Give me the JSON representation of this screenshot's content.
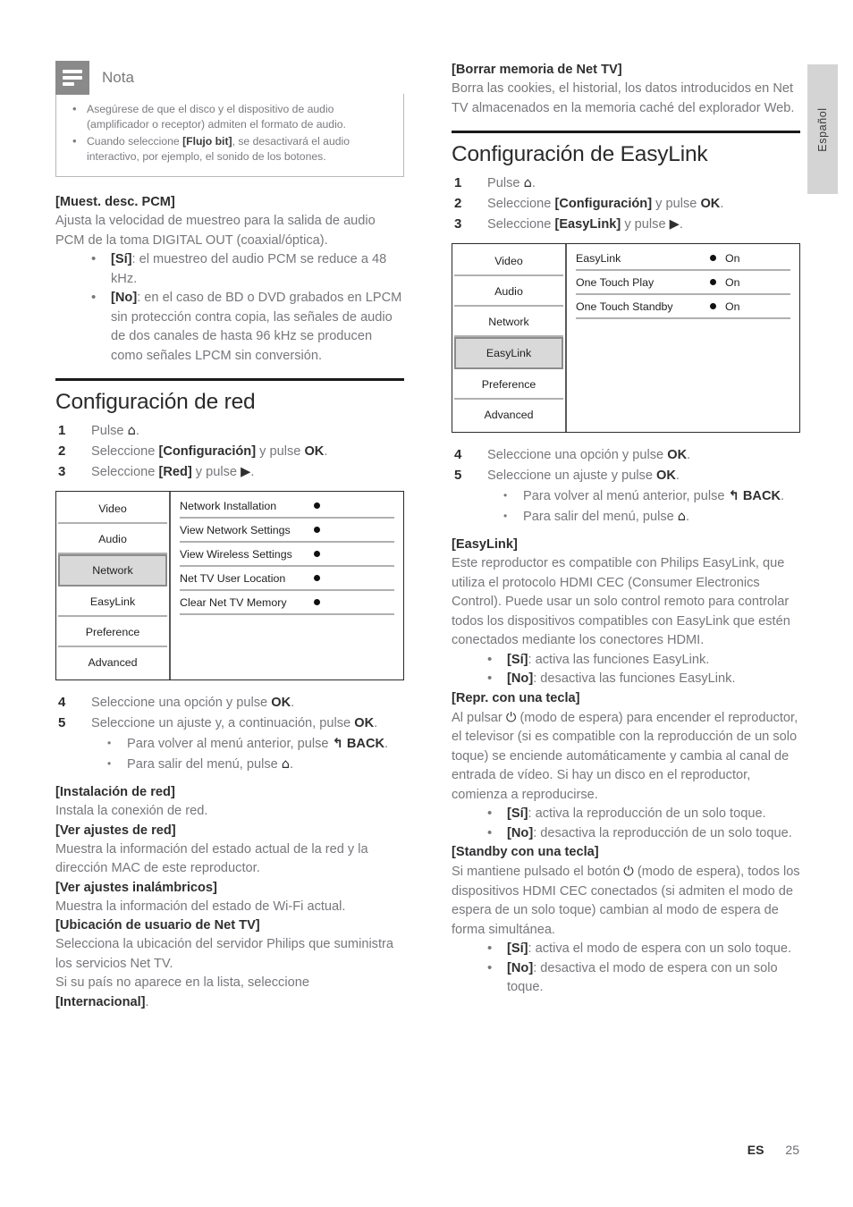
{
  "page": {
    "language_tab": "Español",
    "footer_locale": "ES",
    "footer_page": "25"
  },
  "note": {
    "title": "Nota",
    "items": [
      "Asegúrese de que el disco y el dispositivo de audio (amplificador o receptor) admiten el formato de audio.",
      "Cuando seleccione [Flujo bit], se desactivará el audio interactivo, por ejemplo, el sonido de los botones."
    ],
    "item2_pre": "Cuando seleccione ",
    "item2_bold": "[Flujo bit]",
    "item2_post": ", se desactivará el audio interactivo, por ejemplo, el sonido de los botones."
  },
  "pcm": {
    "term": "[Muest. desc. PCM]",
    "desc": "Ajusta la velocidad de muestreo para la salida de audio PCM de la toma DIGITAL OUT (coaxial/óptica).",
    "bullets": [
      {
        "bold": "[Sí]",
        "text": ": el muestreo del audio PCM se reduce a 48 kHz."
      },
      {
        "bold": "[No]",
        "text": ": en el caso de BD o DVD grabados en LPCM sin protección contra copia, las señales de audio de dos canales de hasta 96 kHz se producen como señales LPCM sin conversión."
      }
    ]
  },
  "network_section": {
    "heading": "Configuración de red",
    "steps": [
      {
        "num": "1",
        "pre": "Pulse ",
        "icon": "home-icon",
        "post": "."
      },
      {
        "num": "2",
        "pre": "Seleccione ",
        "bold": "[Configuración]",
        "mid": " y pulse ",
        "bold2": "OK",
        "post": "."
      },
      {
        "num": "3",
        "pre": "Seleccione ",
        "bold": "[Red]",
        "mid": " y pulse ",
        "icon": "play-right-icon",
        "post": "."
      }
    ],
    "menu": {
      "left_items": [
        "Video",
        "Audio",
        "Network",
        "EasyLink",
        "Preference",
        "Advanced"
      ],
      "selected": "Network",
      "rows": [
        {
          "label": "Network Installation",
          "value": ""
        },
        {
          "label": "View Network Settings",
          "value": ""
        },
        {
          "label": "View Wireless Settings",
          "value": ""
        },
        {
          "label": "Net TV User Location",
          "value": ""
        },
        {
          "label": "Clear Net TV Memory",
          "value": ""
        }
      ]
    },
    "steps2": [
      {
        "num": "4",
        "pre": "Seleccione una opción y pulse ",
        "bold": "OK",
        "post": "."
      },
      {
        "num": "5",
        "pre": "Seleccione un ajuste y, a continuación, pulse ",
        "bold": "OK",
        "post": "."
      }
    ],
    "sub_bullets": [
      {
        "text": "Para volver al menú anterior, pulse ",
        "icon": "back-arrow-icon",
        "bold": "BACK",
        "post": "."
      },
      {
        "text": "Para salir del menú, pulse ",
        "icon": "home-icon",
        "post": "."
      }
    ],
    "defs": [
      {
        "term": "[Instalación de red]",
        "desc": "Instala la conexión de red."
      },
      {
        "term": "[Ver ajustes de red]",
        "desc": "Muestra la información del estado actual de la red y la dirección MAC de este reproductor."
      },
      {
        "term": "[Ver ajustes inalámbricos]",
        "desc": "Muestra la información del estado de Wi-Fi actual."
      },
      {
        "term": "[Ubicación de usuario de Net TV]",
        "desc": "Selecciona la ubicación del servidor Philips que suministra los servicios Net TV."
      }
    ],
    "closing_pre": "Si su país no aparece en la lista, seleccione ",
    "closing_bold": "[Internacional]",
    "closing_post": "."
  },
  "clear_memory": {
    "term": "[Borrar memoria de Net TV]",
    "desc": "Borra las cookies, el historial, los datos introducidos en Net TV almacenados en la memoria caché del explorador Web."
  },
  "easylink_section": {
    "heading": "Configuración de EasyLink",
    "steps": [
      {
        "num": "1",
        "pre": "Pulse ",
        "icon": "home-icon",
        "post": "."
      },
      {
        "num": "2",
        "pre": "Seleccione ",
        "bold": "[Configuración]",
        "mid": " y pulse ",
        "bold2": "OK",
        "post": "."
      },
      {
        "num": "3",
        "pre": "Seleccione ",
        "bold": "[EasyLink]",
        "mid": " y pulse ",
        "icon": "play-right-icon",
        "post": "."
      }
    ],
    "menu": {
      "left_items": [
        "Video",
        "Audio",
        "Network",
        "EasyLink",
        "Preference",
        "Advanced"
      ],
      "selected": "EasyLink",
      "rows": [
        {
          "label": "EasyLink",
          "value": "On"
        },
        {
          "label": "One Touch Play",
          "value": "On"
        },
        {
          "label": "One Touch Standby",
          "value": "On"
        }
      ]
    },
    "steps2": [
      {
        "num": "4",
        "pre": "Seleccione una opción y pulse ",
        "bold": "OK",
        "post": "."
      },
      {
        "num": "5",
        "pre": "Seleccione un ajuste y pulse ",
        "bold": "OK",
        "post": "."
      }
    ],
    "sub_bullets": [
      {
        "text": "Para volver al menú anterior, pulse ",
        "icon": "back-arrow-icon",
        "bold": "BACK",
        "post": "."
      },
      {
        "text": "Para salir del menú, pulse ",
        "icon": "home-icon",
        "post": "."
      }
    ],
    "easylink": {
      "term": "[EasyLink]",
      "desc": "Este reproductor es compatible con Philips EasyLink, que utiliza el protocolo HDMI CEC (Consumer Electronics Control). Puede usar un solo control remoto para controlar todos los dispositivos compatibles con EasyLink que estén conectados mediante los conectores HDMI.",
      "bullets": [
        {
          "bold": "[Sí]",
          "text": ": activa las funciones EasyLink."
        },
        {
          "bold": "[No]",
          "text": ": desactiva las funciones EasyLink."
        }
      ]
    },
    "one_touch_play": {
      "term": "[Repr. con una tecla]",
      "desc_pre": "Al pulsar ",
      "desc_icon": "power-standby-icon",
      "desc_post": " (modo de espera) para encender el reproductor, el televisor (si es compatible con la reproducción de un solo toque) se enciende automáticamente y cambia al canal de entrada de vídeo. Si hay un disco en el reproductor, comienza a reproducirse.",
      "bullets": [
        {
          "bold": "[Sí]",
          "text": ": activa la reproducción de un solo toque."
        },
        {
          "bold": "[No]",
          "text": ": desactiva la reproducción de un solo toque."
        }
      ]
    },
    "one_touch_standby": {
      "term": "[Standby con una tecla]",
      "desc_pre": "Si mantiene pulsado el botón ",
      "desc_icon": "power-standby-icon",
      "desc_post": " (modo de espera), todos los dispositivos HDMI CEC conectados (si admiten el modo de espera de un solo toque) cambian al modo de espera de forma simultánea.",
      "bullets": [
        {
          "bold": "[Sí]",
          "text": ": activa el modo de espera con un solo toque."
        },
        {
          "bold": "[No]",
          "text": ": desactiva el modo de espera con un solo toque."
        }
      ]
    }
  },
  "icons": {
    "home": "⌂",
    "play_right": "▶",
    "back_arrow": "↰",
    "power": "⏻"
  }
}
